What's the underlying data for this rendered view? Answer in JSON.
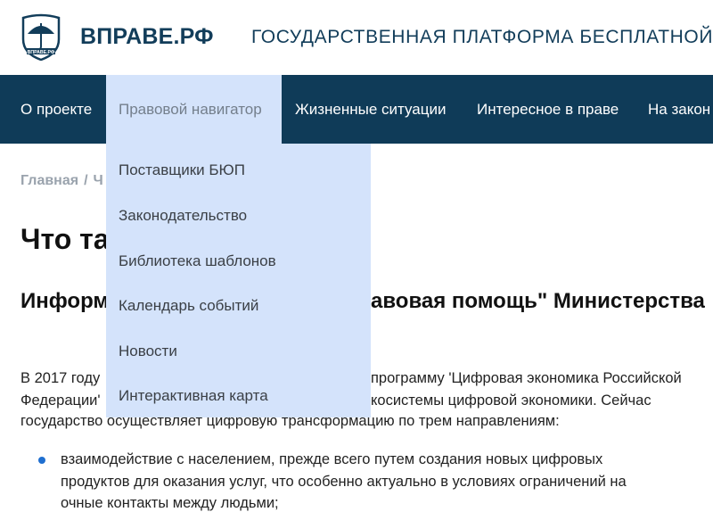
{
  "header": {
    "brand": "ВПРАВЕ.РФ",
    "tagline": "ГОСУДАРСТВЕННАЯ ПЛАТФОРМА БЕСПЛАТНОЙ Ю",
    "logo_text": "ВПРАВЕ.РФ",
    "brand_color": "#123d5a"
  },
  "nav": {
    "background": "#0f3b58",
    "items": [
      {
        "label": "О проекте"
      },
      {
        "label": "Правовой навигатор"
      },
      {
        "label": "Жизненные ситуации"
      },
      {
        "label": "Интересное в праве"
      },
      {
        "label": "На закон"
      }
    ]
  },
  "dropdown": {
    "background": "#d4e3fb",
    "items": [
      {
        "label": "Поставщики БЮП"
      },
      {
        "label": "Законодательство"
      },
      {
        "label": "Библиотека шаблонов"
      },
      {
        "label": "Календарь событий"
      },
      {
        "label": "Новости"
      },
      {
        "label": "Интерактивная карта"
      }
    ]
  },
  "breadcrumb": {
    "home": "Главная",
    "separator": "/",
    "current_fragment": "Ч"
  },
  "content": {
    "title_visible": "Что та",
    "subtitle_left": "Информ",
    "subtitle_right": "авовая помощь\" Министерства",
    "para1_line1_left": "В 2017 году",
    "para1_line1_right": "программу 'Цифровая экономика Российской",
    "para1_line2_left": "Федерации'",
    "para1_line2_right": "косистемы цифровой экономики. Сейчас",
    "para1_line3": "государство осуществляет цифровую трансформацию по трем направлениям:",
    "bullet1_line1": "взаимодействие с населением, прежде всего путем создания новых цифровых",
    "bullet1_line2": "продуктов для оказания услуг, что особенно актуально в условиях ограничений на",
    "bullet1_line3": "очные контакты между людьми;",
    "bullet_color": "#1f6fd0"
  }
}
